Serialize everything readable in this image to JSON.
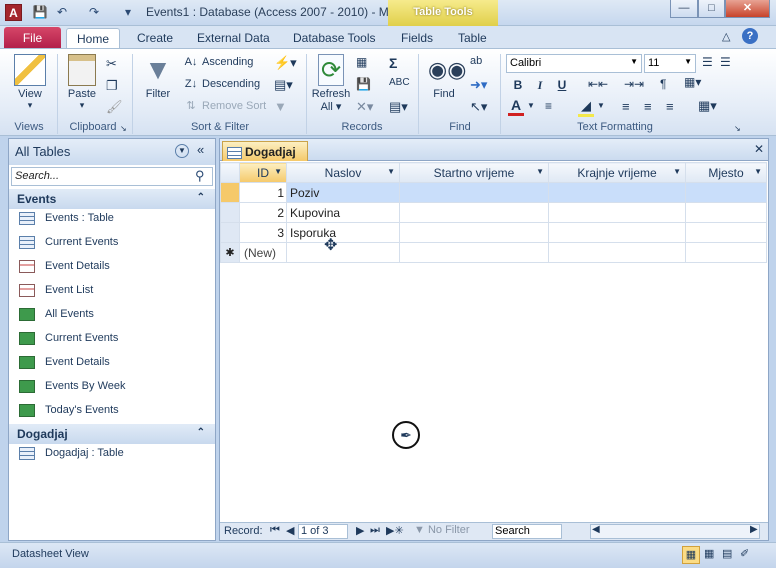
{
  "window": {
    "title": "Events1 : Database (Access 2007 - 2010)  -  M",
    "context_tab": "Table Tools",
    "app_icon": "A"
  },
  "tabs": [
    "File",
    "Home",
    "Create",
    "External Data",
    "Database Tools",
    "Fields",
    "Table"
  ],
  "ribbon": {
    "views": {
      "view_label": "View",
      "group": "Views"
    },
    "clipboard": {
      "paste_label": "Paste",
      "group": "Clipboard"
    },
    "sort_filter": {
      "filter_label": "Filter",
      "ascending": "Ascending",
      "descending": "Descending",
      "remove_sort": "Remove Sort",
      "group": "Sort & Filter"
    },
    "records": {
      "refresh_label": "Refresh",
      "refresh_sub": "All ▾",
      "group": "Records"
    },
    "find": {
      "find_label": "Find",
      "group": "Find"
    },
    "text_formatting": {
      "font": "Calibri",
      "size": "11",
      "bold": "B",
      "italic": "I",
      "underline": "U",
      "group": "Text Formatting"
    }
  },
  "nav": {
    "header": "All Tables",
    "search_placeholder": "Search...",
    "groups": [
      {
        "name": "Events",
        "items": [
          {
            "label": "Events : Table",
            "kind": "tbl"
          },
          {
            "label": "Current Events",
            "kind": "tbl"
          },
          {
            "label": "Event Details",
            "kind": "frm"
          },
          {
            "label": "Event List",
            "kind": "frm"
          },
          {
            "label": "All Events",
            "kind": "rpt"
          },
          {
            "label": "Current Events",
            "kind": "rpt"
          },
          {
            "label": "Event Details",
            "kind": "rpt"
          },
          {
            "label": "Events By Week",
            "kind": "rpt"
          },
          {
            "label": "Today's Events",
            "kind": "rpt"
          }
        ]
      },
      {
        "name": "Dogadjaj",
        "items": [
          {
            "label": "Dogadjaj : Table",
            "kind": "tbl"
          }
        ]
      }
    ]
  },
  "document": {
    "tab": "Dogadjaj",
    "columns": [
      "ID",
      "Naslov",
      "Startno vrijeme",
      "Krajnje vrijeme",
      "Mjesto"
    ],
    "rows": [
      {
        "id": "1",
        "naslov": "Poziv"
      },
      {
        "id": "2",
        "naslov": "Kupovina"
      },
      {
        "id": "3",
        "naslov": "Isporuka"
      }
    ],
    "new_row": "(New)",
    "new_marker": "✱"
  },
  "record_nav": {
    "label": "Record:",
    "position": "1 of 3",
    "filter": "No Filter",
    "search": "Search"
  },
  "status": {
    "text": "Datasheet View"
  }
}
